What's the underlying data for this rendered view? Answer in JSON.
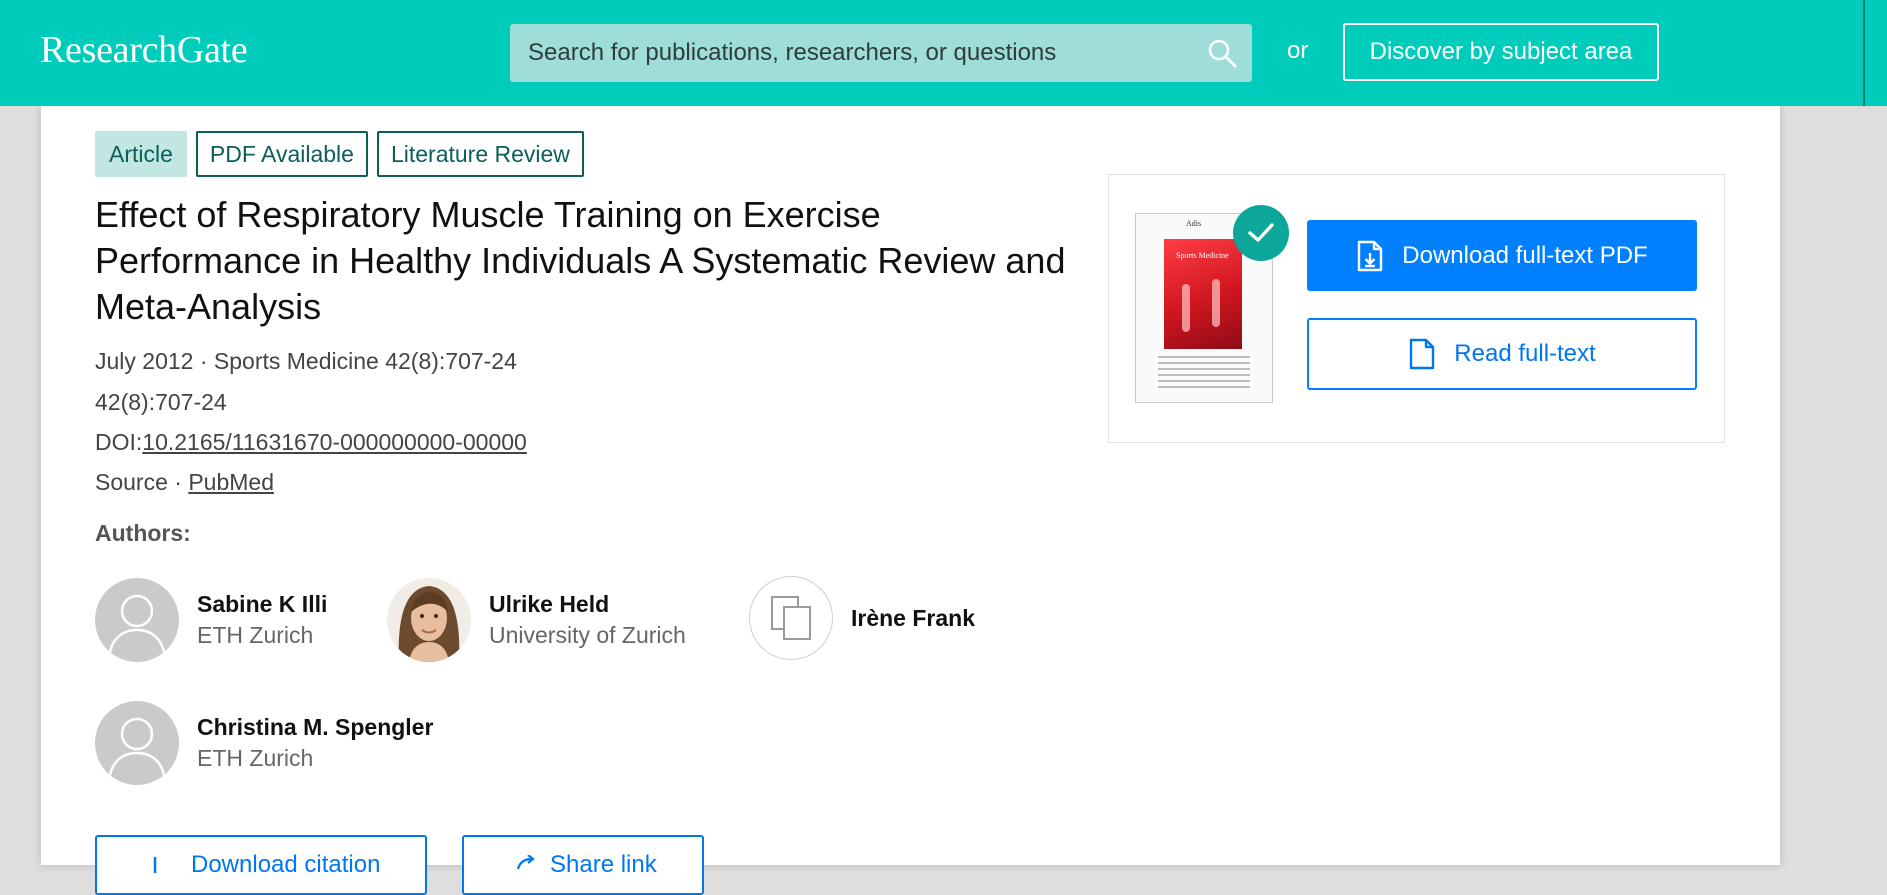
{
  "header": {
    "logo": "ResearchGate",
    "search_placeholder": "Search for publications, researchers, or questions",
    "or_label": "or",
    "discover_label": "Discover by subject area"
  },
  "publication": {
    "tags": [
      "Article",
      "PDF Available",
      "Literature Review"
    ],
    "title": "Effect of Respiratory Muscle Training on Exercise Performance in Healthy Individuals A Systematic Review and Meta-Analysis",
    "date_journal": "July 2012 · Sports Medicine 42(8):707-24",
    "volume": "42(8):707-24",
    "doi_label": "DOI:",
    "doi": "10.2165/11631670-000000000-00000",
    "source_label": "Source · ",
    "source": "PubMed",
    "authors_label": "Authors:",
    "authors": [
      {
        "name": "Sabine K Illi",
        "institution": "ETH Zurich"
      },
      {
        "name": "Ulrike Held",
        "institution": "University of Zurich"
      },
      {
        "name": "Irène Frank",
        "institution": ""
      },
      {
        "name": "Christina M. Spengler",
        "institution": "ETH Zurich"
      }
    ]
  },
  "actions": {
    "download_citation": "Download citation",
    "share": "Share link"
  },
  "pdf_panel": {
    "thumb_brand": "Adis",
    "thumb_journal": "Sports Medicine",
    "download_pdf": "Download full-text PDF",
    "read_fulltext": "Read full-text"
  },
  "colors": {
    "brand": "#00ccbb",
    "primary": "#0080ff",
    "tag_text": "#0b5f58",
    "check": "#0ca69a"
  },
  "icons": {
    "search": "search-icon",
    "check": "check-icon",
    "download_pdf": "file-download-icon",
    "read": "file-icon",
    "author_placeholder": "user-silhouette-icon",
    "author_outline": "documents-icon"
  }
}
